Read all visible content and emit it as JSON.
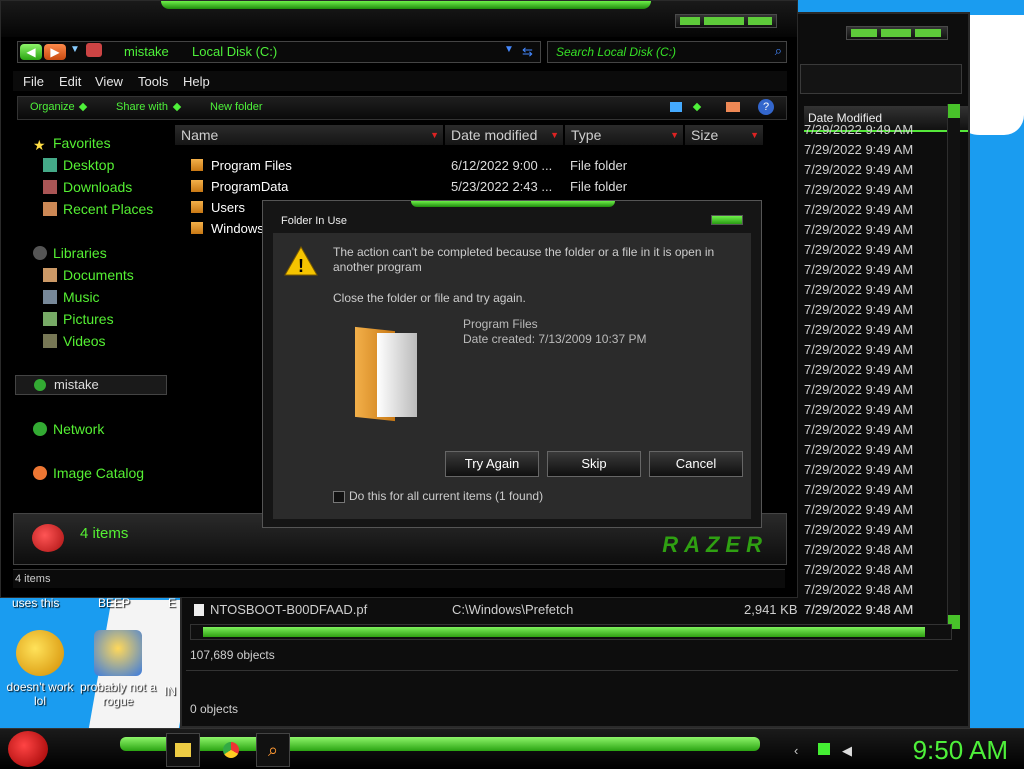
{
  "back_window": {
    "header_date_modified": "Date Modified",
    "dates": [
      "7/29/2022 9:49 AM",
      "7/29/2022 9:49 AM",
      "7/29/2022 9:49 AM",
      "7/29/2022 9:49 AM",
      "7/29/2022 9:49 AM",
      "7/29/2022 9:49 AM",
      "7/29/2022 9:49 AM",
      "7/29/2022 9:49 AM",
      "7/29/2022 9:49 AM",
      "7/29/2022 9:49 AM",
      "7/29/2022 9:49 AM",
      "7/29/2022 9:49 AM",
      "7/29/2022 9:49 AM",
      "7/29/2022 9:49 AM",
      "7/29/2022 9:49 AM",
      "7/29/2022 9:49 AM",
      "7/29/2022 9:49 AM",
      "7/29/2022 9:49 AM",
      "7/29/2022 9:49 AM",
      "7/29/2022 9:49 AM",
      "7/29/2022 9:49 AM",
      "7/29/2022 9:48 AM",
      "7/29/2022 9:48 AM",
      "7/29/2022 9:48 AM",
      "7/29/2022 9:48 AM"
    ],
    "file_row": {
      "name": "NTOSBOOT-B00DFAAD.pf",
      "folder": "C:\\Windows\\Prefetch",
      "size": "2,941 KB",
      "date": "7/29/2022 9:48 AM"
    },
    "objects_1": "107,689 objects",
    "objects_2": "0 objects"
  },
  "desktop": {
    "label_uses_this": "uses this",
    "label_beep": "BEEP",
    "label_e": "E",
    "label_in": "IN",
    "icon1_label": "doesn't work lol",
    "icon2_label": "probably not a rogue"
  },
  "explorer": {
    "address": {
      "user": "mistake",
      "location": "Local Disk (C:)"
    },
    "search_placeholder": "Search Local Disk (C:)",
    "menu": [
      "File",
      "Edit",
      "View",
      "Tools",
      "Help"
    ],
    "commands": {
      "organize": "Organize",
      "share_with": "Share with",
      "new_folder": "New folder"
    },
    "nav": {
      "favorites": "Favorites",
      "desktop": "Desktop",
      "downloads": "Downloads",
      "recent": "Recent Places",
      "libraries": "Libraries",
      "documents": "Documents",
      "music": "Music",
      "pictures": "Pictures",
      "videos": "Videos",
      "mistake": "mistake",
      "network": "Network",
      "image_catalog": "Image Catalog"
    },
    "columns": {
      "name": "Name",
      "date": "Date modified",
      "type": "Type",
      "size": "Size"
    },
    "files": [
      {
        "name": "Program Files",
        "date": "6/12/2022 9:00 ...",
        "type": "File folder"
      },
      {
        "name": "ProgramData",
        "date": "5/23/2022 2:43 ...",
        "type": "File folder"
      },
      {
        "name": "Users",
        "date": "",
        "type": ""
      },
      {
        "name": "Windows",
        "date": "",
        "type": ""
      }
    ],
    "details_count": "4 items",
    "brand": "RAZER",
    "status": "4 items"
  },
  "dialog": {
    "title": "Folder In Use",
    "message": "The action can't be completed because the folder or a file in it is open in another program",
    "message2": "Close the folder or file and try again.",
    "file_name": "Program Files",
    "file_date": "Date created: 7/13/2009 10:37 PM",
    "btn_try_again": "Try Again",
    "btn_skip": "Skip",
    "btn_cancel": "Cancel",
    "checkbox_label": "Do this for all current items (1 found)"
  },
  "taskbar": {
    "clock": "9:50 AM"
  },
  "colors": {
    "accent": "#4ef03a",
    "background": "#000000",
    "desktop": "#1a9cf0"
  }
}
